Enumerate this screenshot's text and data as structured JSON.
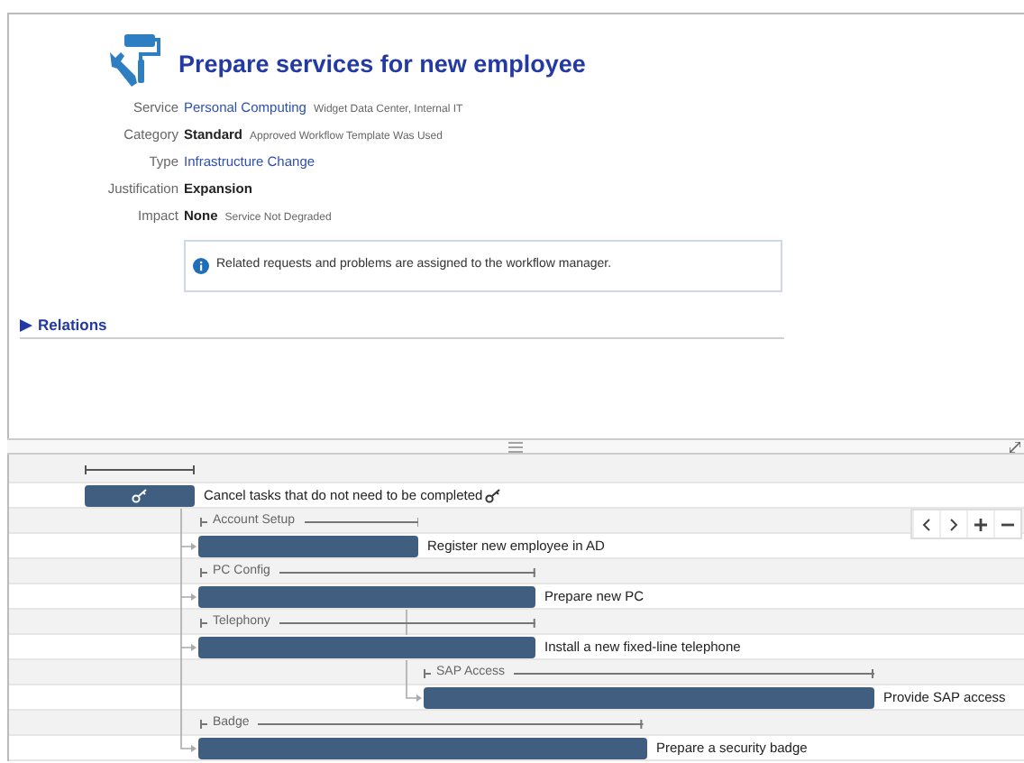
{
  "header": {
    "title": "Prepare services for new employee"
  },
  "fields": [
    {
      "label": "Service",
      "value": "Personal Computing",
      "kind": "link",
      "note": "Widget Data Center, Internal IT"
    },
    {
      "label": "Category",
      "value": "Standard",
      "kind": "plain",
      "note": "Approved Workflow Template Was Used"
    },
    {
      "label": "Type",
      "value": "Infrastructure Change",
      "kind": "link"
    },
    {
      "label": "Justification",
      "value": "Expansion",
      "kind": "plain"
    },
    {
      "label": "Impact",
      "value": "None",
      "kind": "plain",
      "note": "Service Not Degraded"
    }
  ],
  "info": {
    "text": "Related requests and problems are assigned to the workflow manager."
  },
  "relations": {
    "label": "Relations",
    "expanded": false
  },
  "gantt": {
    "rows": [
      {
        "kind": "summary"
      },
      {
        "kind": "milestone",
        "label": "Cancel tasks that do not need to be completed"
      },
      {
        "kind": "group",
        "label": "Account Setup"
      },
      {
        "kind": "task",
        "label": "Register new employee in AD"
      },
      {
        "kind": "group",
        "label": "PC Config"
      },
      {
        "kind": "task",
        "label": "Prepare new PC"
      },
      {
        "kind": "group",
        "label": "Telephony"
      },
      {
        "kind": "task",
        "label": "Install a new fixed-line telephone"
      },
      {
        "kind": "group",
        "label": "SAP Access"
      },
      {
        "kind": "task",
        "label": "Provide SAP access"
      },
      {
        "kind": "group",
        "label": "Badge"
      },
      {
        "kind": "task",
        "label": "Prepare a security badge"
      }
    ]
  }
}
